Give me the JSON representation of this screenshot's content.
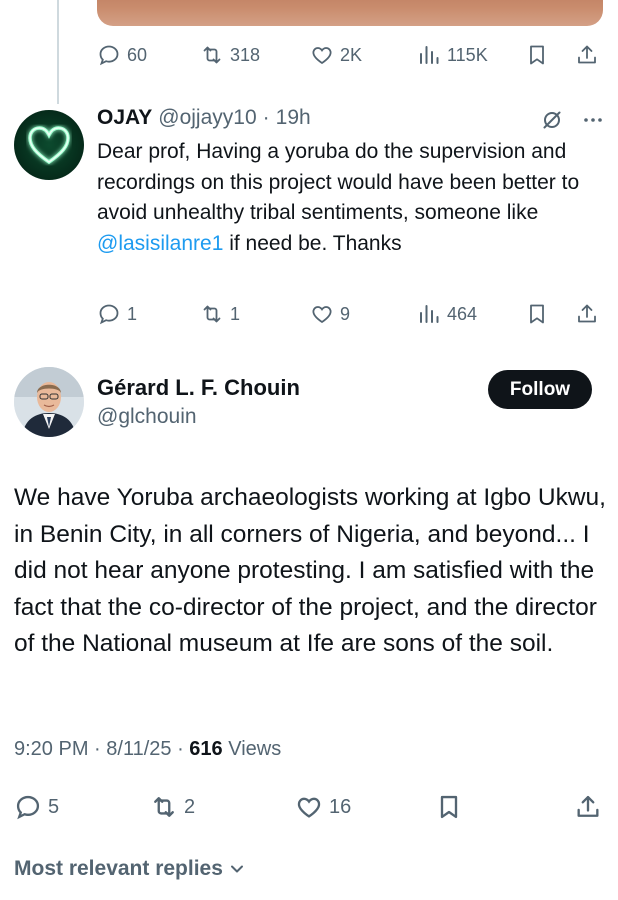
{
  "top_tweet": {
    "replies": "60",
    "reposts": "318",
    "likes": "2K",
    "views": "115K"
  },
  "reply": {
    "name": "OJAY",
    "handle": "@ojjayy10",
    "time": "19h",
    "text_before": "Dear prof, Having a yoruba do the supervision and recordings on this project would have been better to avoid unhealthy tribal sentiments, someone like ",
    "mention": "@lasisilanre1",
    "text_after": " if need be. Thanks",
    "replies": "1",
    "reposts": "1",
    "likes": "9",
    "views": "464"
  },
  "main_tweet": {
    "name": "Gérard L. F. Chouin",
    "handle": "@glchouin",
    "follow_label": "Follow",
    "text": "We have Yoruba archaeologists working at Igbo Ukwu, in Benin City, in all corners of Nigeria, and beyond... I did not hear anyone protesting. I am satisfied with the fact that the co-director of the project, and the director of the National museum at Ife are sons of the soil.",
    "time": "9:20 PM",
    "date": "8/11/25",
    "views_count": "616",
    "views_label": "Views",
    "replies": "5",
    "reposts": "2",
    "likes": "16"
  },
  "sort_label": "Most relevant replies",
  "colors": {
    "text": "#0f1419",
    "muted": "#536471",
    "link": "#1d9bf0",
    "divider": "#cfd9de"
  }
}
